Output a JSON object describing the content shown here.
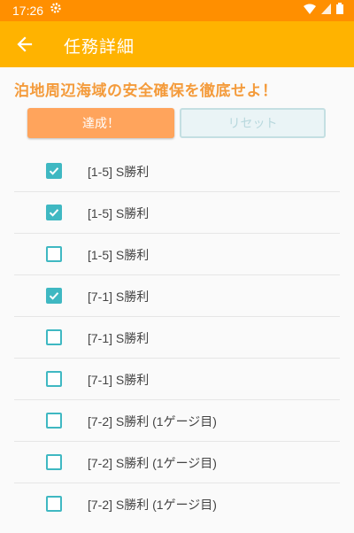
{
  "status_bar": {
    "time": "17:26"
  },
  "app_bar": {
    "title": "任務詳細"
  },
  "quest": {
    "title": "泊地周辺海域の安全確保を徹底せよ！"
  },
  "buttons": {
    "achieve": "達成！",
    "reset": "リセット"
  },
  "items": [
    {
      "label": "[1-5] S勝利",
      "checked": true
    },
    {
      "label": "[1-5] S勝利",
      "checked": true
    },
    {
      "label": "[1-5] S勝利",
      "checked": false
    },
    {
      "label": "[7-1] S勝利",
      "checked": true
    },
    {
      "label": "[7-1] S勝利",
      "checked": false
    },
    {
      "label": "[7-1] S勝利",
      "checked": false
    },
    {
      "label": "[7-2] S勝利 (1ゲージ目)",
      "checked": false
    },
    {
      "label": "[7-2] S勝利 (1ゲージ目)",
      "checked": false
    },
    {
      "label": "[7-2] S勝利 (1ゲージ目)",
      "checked": false
    }
  ],
  "colors": {
    "status_bar": "#ff8f00",
    "app_bar": "#ffb300",
    "quest_title": "#f49b3b",
    "achieve_button": "#ffa45c",
    "checkbox": "#3fb8c2"
  }
}
